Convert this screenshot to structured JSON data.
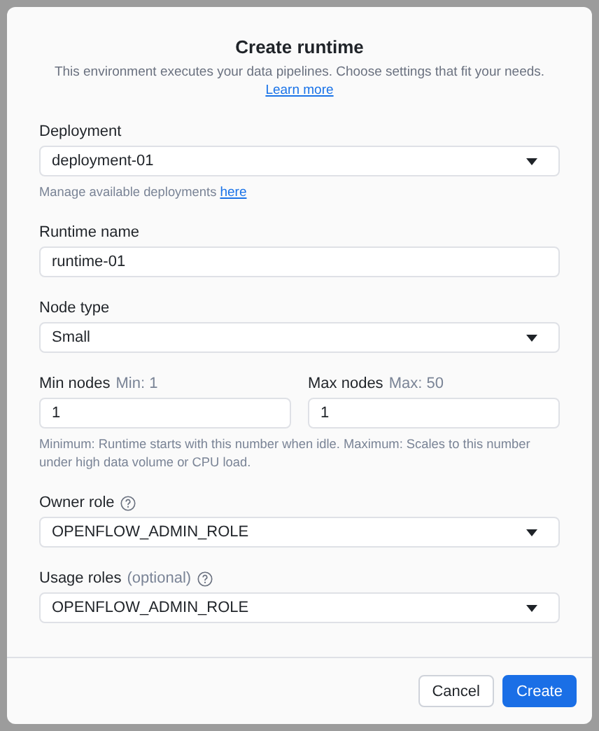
{
  "dialog": {
    "title": "Create runtime",
    "subtitle": "This environment executes your data pipelines. Choose settings that fit your needs.",
    "link": "Learn more"
  },
  "fields": [
    {
      "kind": "select",
      "label": "Deployment",
      "value": "deployment-01",
      "help": "Manage available deployments",
      "help_link": "here"
    },
    {
      "kind": "text",
      "label": "Runtime name",
      "value": "runtime-01"
    },
    {
      "kind": "select",
      "label": "Node type",
      "value": "Small"
    },
    {
      "kind": "pair",
      "items": [
        {
          "label": "Min nodes",
          "hint": "Min: 1",
          "value": "1"
        },
        {
          "label": "Max nodes",
          "hint": "Max: 50",
          "value": "1"
        }
      ],
      "help": "Minimum: Runtime starts with this number when idle. Maximum: Scales to this number under high data volume or CPU load."
    },
    {
      "kind": "select",
      "label": "Owner role",
      "info": true,
      "value": "OPENFLOW_ADMIN_ROLE"
    },
    {
      "kind": "select",
      "label": "Usage roles",
      "note": "(optional)",
      "info": true,
      "value": "OPENFLOW_ADMIN_ROLE"
    }
  ],
  "buttons": [
    {
      "label": "Cancel",
      "primary": false
    },
    {
      "label": "Create",
      "primary": true
    }
  ]
}
